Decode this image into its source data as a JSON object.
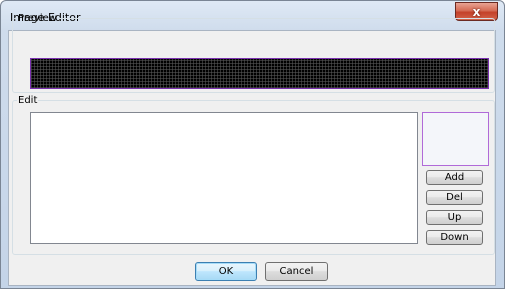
{
  "window": {
    "title": "Image Editor"
  },
  "titlebar": {
    "close_glyph": "x",
    "close_icon": "close-icon"
  },
  "preview": {
    "legend": "Preview"
  },
  "edit": {
    "legend": "Edit"
  },
  "list": {
    "items": []
  },
  "side_buttons": {
    "add": "Add",
    "del": "Del",
    "up": "Up",
    "down": "Down"
  },
  "footer": {
    "ok": "OK",
    "cancel": "Cancel"
  },
  "colors": {
    "preview_border": "#7a2fb0",
    "thumbnail_border": "#b06ad8",
    "close_button": "#c4412a",
    "default_button_border": "#3c7fb1"
  }
}
